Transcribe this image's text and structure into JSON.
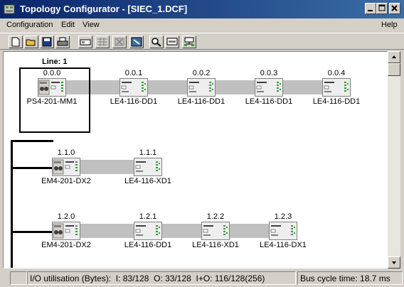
{
  "window": {
    "title": "Topology Configurator - [SIEC_1.DCF]"
  },
  "menu": [
    "Configuration",
    "Edit",
    "View",
    "Help"
  ],
  "toolbar_icons": [
    "new-icon",
    "open-icon",
    "save-icon",
    "print-icon",
    "module-icon",
    "grid-icon",
    "delete-icon",
    "config-icon",
    "zoom-icon",
    "monitor-icon",
    "network-icon"
  ],
  "canvas": {
    "line_label": "Line: 1",
    "lines": [
      {
        "modules": [
          {
            "address": "0.0.0",
            "name": "PS4-201-MM1",
            "kind": "master"
          },
          {
            "address": "0.0.1",
            "name": "LE4-116-DD1",
            "kind": "le"
          },
          {
            "address": "0.0.2",
            "name": "LE4-116-DD1",
            "kind": "le"
          },
          {
            "address": "0.0.3",
            "name": "LE4-116-DD1",
            "kind": "le"
          },
          {
            "address": "0.0.4",
            "name": "LE4-116-DD1",
            "kind": "le"
          }
        ]
      },
      {
        "modules": [
          {
            "address": "1.1.0",
            "name": "EM4-201-DX2",
            "kind": "em"
          },
          {
            "address": "1.1.1",
            "name": "LE4-116-XD1",
            "kind": "le"
          }
        ]
      },
      {
        "modules": [
          {
            "address": "1.2.0",
            "name": "EM4-201-DX2",
            "kind": "em"
          },
          {
            "address": "1.2.1",
            "name": "LE4-116-DD1",
            "kind": "le"
          },
          {
            "address": "1.2.2",
            "name": "LE4-116-XD1",
            "kind": "le"
          },
          {
            "address": "1.2.3",
            "name": "LE4-116-DX1",
            "kind": "le"
          }
        ]
      }
    ]
  },
  "status": {
    "io_label": "I/O utilisation (Bytes):",
    "i_label": "I:",
    "i_value": "83/128",
    "o_label": "O:",
    "o_value": "33/128",
    "io_sum_label": "I+O:",
    "io_sum_value": "116/128(256)",
    "bus_cycle": "Bus cycle time:  18.7 ms"
  },
  "colors": {
    "title_start": "#0a246a",
    "title_end": "#3a6ea5",
    "bus_band": "#c0c0c0",
    "led": "#2e9e2e"
  }
}
